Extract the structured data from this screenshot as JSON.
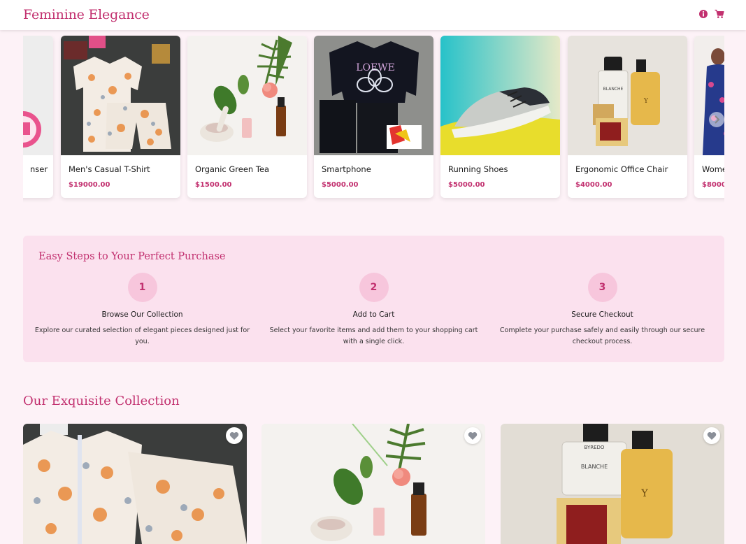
{
  "header": {
    "brand": "Feminine Elegance",
    "icons": [
      "info-icon",
      "cart-icon"
    ],
    "accent": "#c2306f"
  },
  "carousel": {
    "items": [
      {
        "name": "nser",
        "price": ""
      },
      {
        "name": "Men's Casual T-Shirt",
        "price": "$19000.00"
      },
      {
        "name": "Organic Green Tea",
        "price": "$1500.00"
      },
      {
        "name": "Smartphone",
        "price": "$5000.00"
      },
      {
        "name": "Running Shoes",
        "price": "$5000.00"
      },
      {
        "name": "Ergonomic Office Chair",
        "price": "$4000.00"
      },
      {
        "name": "Wome",
        "price": "$8000."
      }
    ],
    "next_icon": "chevron-right-icon"
  },
  "steps": {
    "title": "Easy Steps to Your Perfect Purchase",
    "items": [
      {
        "num": "1",
        "title": "Browse Our Collection",
        "desc": "Explore our curated selection of elegant pieces designed just for you."
      },
      {
        "num": "2",
        "title": "Add to Cart",
        "desc": "Select your favorite items and add them to your shopping cart with a single click."
      },
      {
        "num": "3",
        "title": "Secure Checkout",
        "desc": "Complete your purchase safely and easily through our secure checkout process."
      }
    ]
  },
  "collection": {
    "title": "Our Exquisite Collection",
    "favorite_icon": "heart-icon"
  }
}
